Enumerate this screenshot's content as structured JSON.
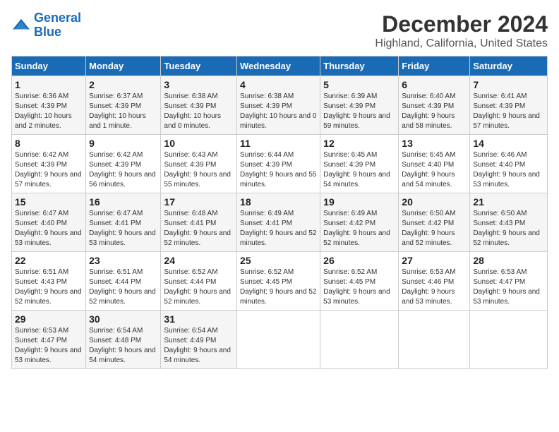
{
  "header": {
    "logo_line1": "General",
    "logo_line2": "Blue",
    "title": "December 2024",
    "subtitle": "Highland, California, United States"
  },
  "weekdays": [
    "Sunday",
    "Monday",
    "Tuesday",
    "Wednesday",
    "Thursday",
    "Friday",
    "Saturday"
  ],
  "weeks": [
    [
      {
        "day": "1",
        "sunrise": "Sunrise: 6:36 AM",
        "sunset": "Sunset: 4:39 PM",
        "daylight": "Daylight: 10 hours and 2 minutes."
      },
      {
        "day": "2",
        "sunrise": "Sunrise: 6:37 AM",
        "sunset": "Sunset: 4:39 PM",
        "daylight": "Daylight: 10 hours and 1 minute."
      },
      {
        "day": "3",
        "sunrise": "Sunrise: 6:38 AM",
        "sunset": "Sunset: 4:39 PM",
        "daylight": "Daylight: 10 hours and 0 minutes."
      },
      {
        "day": "4",
        "sunrise": "Sunrise: 6:38 AM",
        "sunset": "Sunset: 4:39 PM",
        "daylight": "Daylight: 10 hours and 0 minutes."
      },
      {
        "day": "5",
        "sunrise": "Sunrise: 6:39 AM",
        "sunset": "Sunset: 4:39 PM",
        "daylight": "Daylight: 9 hours and 59 minutes."
      },
      {
        "day": "6",
        "sunrise": "Sunrise: 6:40 AM",
        "sunset": "Sunset: 4:39 PM",
        "daylight": "Daylight: 9 hours and 58 minutes."
      },
      {
        "day": "7",
        "sunrise": "Sunrise: 6:41 AM",
        "sunset": "Sunset: 4:39 PM",
        "daylight": "Daylight: 9 hours and 57 minutes."
      }
    ],
    [
      {
        "day": "8",
        "sunrise": "Sunrise: 6:42 AM",
        "sunset": "Sunset: 4:39 PM",
        "daylight": "Daylight: 9 hours and 57 minutes."
      },
      {
        "day": "9",
        "sunrise": "Sunrise: 6:42 AM",
        "sunset": "Sunset: 4:39 PM",
        "daylight": "Daylight: 9 hours and 56 minutes."
      },
      {
        "day": "10",
        "sunrise": "Sunrise: 6:43 AM",
        "sunset": "Sunset: 4:39 PM",
        "daylight": "Daylight: 9 hours and 55 minutes."
      },
      {
        "day": "11",
        "sunrise": "Sunrise: 6:44 AM",
        "sunset": "Sunset: 4:39 PM",
        "daylight": "Daylight: 9 hours and 55 minutes."
      },
      {
        "day": "12",
        "sunrise": "Sunrise: 6:45 AM",
        "sunset": "Sunset: 4:39 PM",
        "daylight": "Daylight: 9 hours and 54 minutes."
      },
      {
        "day": "13",
        "sunrise": "Sunrise: 6:45 AM",
        "sunset": "Sunset: 4:40 PM",
        "daylight": "Daylight: 9 hours and 54 minutes."
      },
      {
        "day": "14",
        "sunrise": "Sunrise: 6:46 AM",
        "sunset": "Sunset: 4:40 PM",
        "daylight": "Daylight: 9 hours and 53 minutes."
      }
    ],
    [
      {
        "day": "15",
        "sunrise": "Sunrise: 6:47 AM",
        "sunset": "Sunset: 4:40 PM",
        "daylight": "Daylight: 9 hours and 53 minutes."
      },
      {
        "day": "16",
        "sunrise": "Sunrise: 6:47 AM",
        "sunset": "Sunset: 4:41 PM",
        "daylight": "Daylight: 9 hours and 53 minutes."
      },
      {
        "day": "17",
        "sunrise": "Sunrise: 6:48 AM",
        "sunset": "Sunset: 4:41 PM",
        "daylight": "Daylight: 9 hours and 52 minutes."
      },
      {
        "day": "18",
        "sunrise": "Sunrise: 6:49 AM",
        "sunset": "Sunset: 4:41 PM",
        "daylight": "Daylight: 9 hours and 52 minutes."
      },
      {
        "day": "19",
        "sunrise": "Sunrise: 6:49 AM",
        "sunset": "Sunset: 4:42 PM",
        "daylight": "Daylight: 9 hours and 52 minutes."
      },
      {
        "day": "20",
        "sunrise": "Sunrise: 6:50 AM",
        "sunset": "Sunset: 4:42 PM",
        "daylight": "Daylight: 9 hours and 52 minutes."
      },
      {
        "day": "21",
        "sunrise": "Sunrise: 6:50 AM",
        "sunset": "Sunset: 4:43 PM",
        "daylight": "Daylight: 9 hours and 52 minutes."
      }
    ],
    [
      {
        "day": "22",
        "sunrise": "Sunrise: 6:51 AM",
        "sunset": "Sunset: 4:43 PM",
        "daylight": "Daylight: 9 hours and 52 minutes."
      },
      {
        "day": "23",
        "sunrise": "Sunrise: 6:51 AM",
        "sunset": "Sunset: 4:44 PM",
        "daylight": "Daylight: 9 hours and 52 minutes."
      },
      {
        "day": "24",
        "sunrise": "Sunrise: 6:52 AM",
        "sunset": "Sunset: 4:44 PM",
        "daylight": "Daylight: 9 hours and 52 minutes."
      },
      {
        "day": "25",
        "sunrise": "Sunrise: 6:52 AM",
        "sunset": "Sunset: 4:45 PM",
        "daylight": "Daylight: 9 hours and 52 minutes."
      },
      {
        "day": "26",
        "sunrise": "Sunrise: 6:52 AM",
        "sunset": "Sunset: 4:45 PM",
        "daylight": "Daylight: 9 hours and 53 minutes."
      },
      {
        "day": "27",
        "sunrise": "Sunrise: 6:53 AM",
        "sunset": "Sunset: 4:46 PM",
        "daylight": "Daylight: 9 hours and 53 minutes."
      },
      {
        "day": "28",
        "sunrise": "Sunrise: 6:53 AM",
        "sunset": "Sunset: 4:47 PM",
        "daylight": "Daylight: 9 hours and 53 minutes."
      }
    ],
    [
      {
        "day": "29",
        "sunrise": "Sunrise: 6:53 AM",
        "sunset": "Sunset: 4:47 PM",
        "daylight": "Daylight: 9 hours and 53 minutes."
      },
      {
        "day": "30",
        "sunrise": "Sunrise: 6:54 AM",
        "sunset": "Sunset: 4:48 PM",
        "daylight": "Daylight: 9 hours and 54 minutes."
      },
      {
        "day": "31",
        "sunrise": "Sunrise: 6:54 AM",
        "sunset": "Sunset: 4:49 PM",
        "daylight": "Daylight: 9 hours and 54 minutes."
      },
      null,
      null,
      null,
      null
    ]
  ]
}
